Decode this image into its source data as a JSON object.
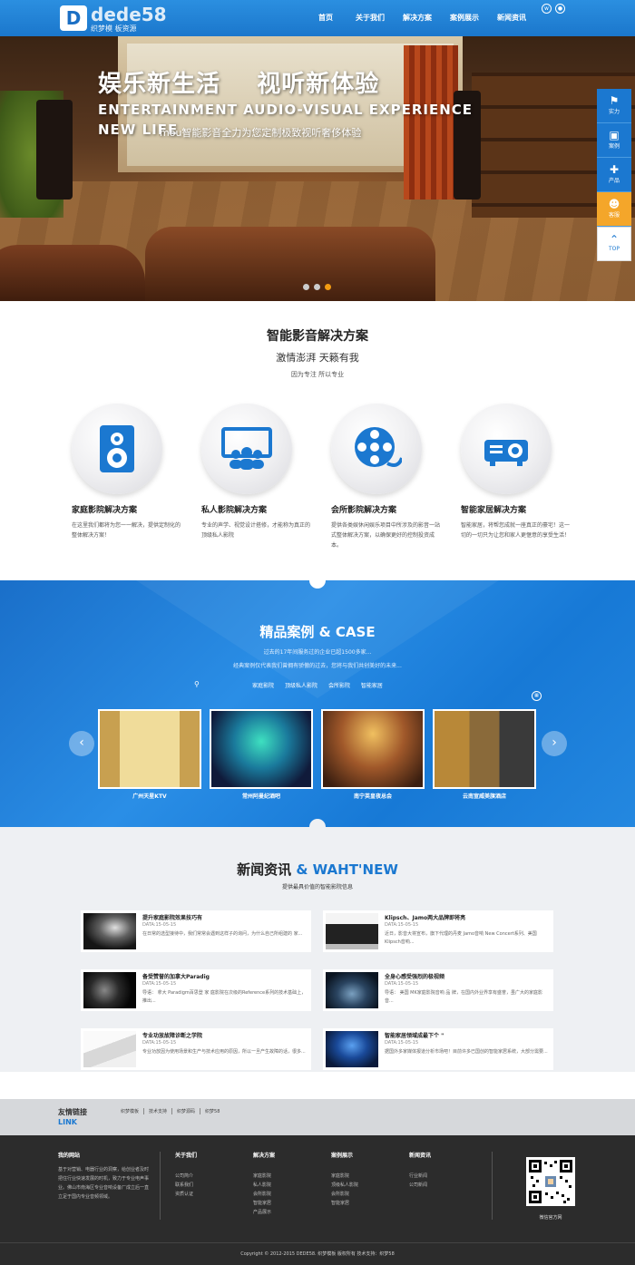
{
  "header": {
    "logo_mark": "D",
    "logo_text": "dede58",
    "logo_sub": "织梦模 板资源",
    "nav": [
      "首页",
      "关于我们",
      "解决方案",
      "案例展示",
      "新闻资讯"
    ]
  },
  "banner": {
    "title": "娱乐新生活    视听新体验",
    "en_line1": "ENTERTAINMENT AUDIO-VISUAL EXPERIENCE",
    "en_line2": "NEW LIFE",
    "sub": "mou智能影音全力为您定制极致视听奢侈体验",
    "active_slide": 3,
    "slide_count": 3
  },
  "side_toolbar": [
    {
      "icon": "flag-icon",
      "label": "实力"
    },
    {
      "icon": "image-icon",
      "label": "案例"
    },
    {
      "icon": "puzzle-icon",
      "label": "产品"
    },
    {
      "icon": "qq-icon",
      "label": "客服"
    },
    {
      "icon": "chevron-up-icon",
      "label": "TOP"
    }
  ],
  "solutions": {
    "title": "智能影音解决方案",
    "subtitle": "激情澎湃 天籁有我",
    "tagline": "因为专注 所以专业",
    "items": [
      {
        "icon": "speaker-icon",
        "name": "家庭影院解决方案",
        "desc": "在这里我们都将为您一一解决，提供定制化的整体解决方案！"
      },
      {
        "icon": "audience-screen-icon",
        "name": "私人影院解决方案",
        "desc": "专业的声学、视觉设计搭修，才能称为真正的顶级私人影院"
      },
      {
        "icon": "film-reel-icon",
        "name": "会所影院解决方案",
        "desc": "提供各类娱休闲娱乐项目中所涉及的影音一站式整体解决方案，以确保更好的控制投资成本。"
      },
      {
        "icon": "projector-icon",
        "name": "智能家居解决方案",
        "desc": "智能家居，将帮您成就一座真正的豪宅！这一切的一切只为让您和家人更惬意的享受生活！"
      }
    ]
  },
  "cases": {
    "title": "精品案例 & CASE",
    "text1": "过去的17年间服务过的企业已超1500多家...",
    "text2": "经典案例仅代表我们曾拥有骄傲的过去，您将与我们共创美好的未来...",
    "tabs": [
      "家庭影院",
      "顶级私人影院",
      "会所影院",
      "智能家居"
    ],
    "items": [
      "广州天星KTV",
      "常州阿曼纪酒吧",
      "南宁英皇夜总会",
      "云南宣威美旗酒店"
    ],
    "prev": "‹",
    "next": "›",
    "pin": "⚲",
    "grid": "▦"
  },
  "news": {
    "title_cn": "新闻资讯",
    "title_en": " & WAHT'NEW",
    "sub": "提供最具价值的智能影院信息",
    "items": [
      {
        "title": "提升家庭影院效果技巧有",
        "date": "DATA:15-05-15",
        "text": "在日常的选型接待中，我们常常会遇到这样子的询问，为什么自己所组建的 家..."
      },
      {
        "title": "Klipsch、Jamo两大品牌即将亮",
        "date": "DATA:15-05-15",
        "text": "近日，影音大将宣布，旗下代理的丹麦 Jamo音响 New Concert系列、美国 Klipsch音响..."
      },
      {
        "title": "备受赞誉的加拿大Paradig",
        "date": "DATA:15-05-15",
        "text": "导语： 拿大 Paradigm百思登 家 庭影院在次级的Reference系列的技术基础上，推出..."
      },
      {
        "title": "全身心感受强烈的极视频",
        "date": "DATA:15-05-15",
        "text": "导语： 美国 MK家庭影院音响 品 牌，在国内外业界享有盛誉，虽广大的家庭影音..."
      },
      {
        "title": "专业功放故障诊断之学院",
        "date": "DATA:15-05-15",
        "text": "专业功放因为使用场景和生产与技术应用的原因，所以一旦产生故障的话，很多..."
      },
      {
        "title": "智能家居领域成最下个 \"",
        "date": "DATA:15-05-15",
        "text": "据国外多家媒体报道分析市场吧！目前许多已国创的智能家居系统，大部分需要..."
      }
    ]
  },
  "links": {
    "heading": "友情链接",
    "heading_en": "LINK",
    "items": [
      "织梦模板",
      "技术支持",
      "织梦源码",
      "织梦58"
    ]
  },
  "footer": {
    "about_title": "我的网站",
    "about_text": "基于对营销、电器行业的洞察，给创业者及时把住行业快速发展的时机，致力于专业电声事业。佛山市南海区专业音响设备厂成立后一直立足于国内专业音频领域。",
    "cols": [
      {
        "title": "关于我们",
        "items": [
          "公司简介",
          "联系我们",
          "资质认证"
        ]
      },
      {
        "title": "解决方案",
        "items": [
          "家庭影院",
          "私人影院",
          "会所影院",
          "智能家居",
          "产品展示"
        ]
      },
      {
        "title": "案例展示",
        "items": [
          "家庭影院",
          "顶级私人影院",
          "会所影院",
          "智能家居"
        ]
      },
      {
        "title": "新闻资讯",
        "items": [
          "行业新闻",
          "公司新闻"
        ]
      }
    ],
    "qr_caption": "微信官方网",
    "copyright": "Copyright © 2012-2015 DEDE58. 织梦模板 版权所有 技术支持：织梦58"
  },
  "colors": {
    "brand_blue": "#1b78d0",
    "accent_orange": "#f39c12",
    "qq_orange": "#f4a62a",
    "footer_bg": "#2c2c2c"
  }
}
